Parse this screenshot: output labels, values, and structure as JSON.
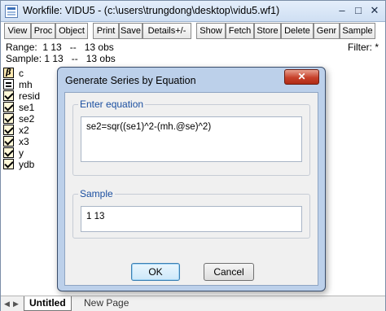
{
  "workfile": {
    "title": "Workfile: VIDU5 - (c:\\users\\trungdong\\desktop\\vidu5.wf1)",
    "controls": {
      "minimize": "–",
      "maximize": "□",
      "close": "✕"
    },
    "toolbar": [
      "View",
      "Proc",
      "Object",
      "Print",
      "Save",
      "Details+/-",
      "Show",
      "Fetch",
      "Store",
      "Delete",
      "Genr",
      "Sample"
    ],
    "range_text": "Range:  1 13   --   13 obs",
    "sample_text": "Sample: 1 13   --   13 obs",
    "filter_text": "Filter: *",
    "objects": [
      {
        "name": "c",
        "icon": "coefficient-icon"
      },
      {
        "name": "mh",
        "icon": "equation-icon"
      },
      {
        "name": "resid",
        "icon": "series-icon"
      },
      {
        "name": "se1",
        "icon": "series-icon"
      },
      {
        "name": "se2",
        "icon": "series-icon"
      },
      {
        "name": "x2",
        "icon": "series-icon"
      },
      {
        "name": "x3",
        "icon": "series-icon"
      },
      {
        "name": "y",
        "icon": "series-icon"
      },
      {
        "name": "ydb",
        "icon": "series-icon"
      }
    ],
    "tabs": {
      "active": "Untitled",
      "inactive": "New Page"
    }
  },
  "dialog": {
    "title": "Generate Series by Equation",
    "close_label": "✕",
    "equation_legend": "Enter equation",
    "equation_value": "se2=sqr((se1)^2-(mh.@se)^2)",
    "sample_legend": "Sample",
    "sample_value": "1 13",
    "ok_label": "OK",
    "cancel_label": "Cancel"
  }
}
